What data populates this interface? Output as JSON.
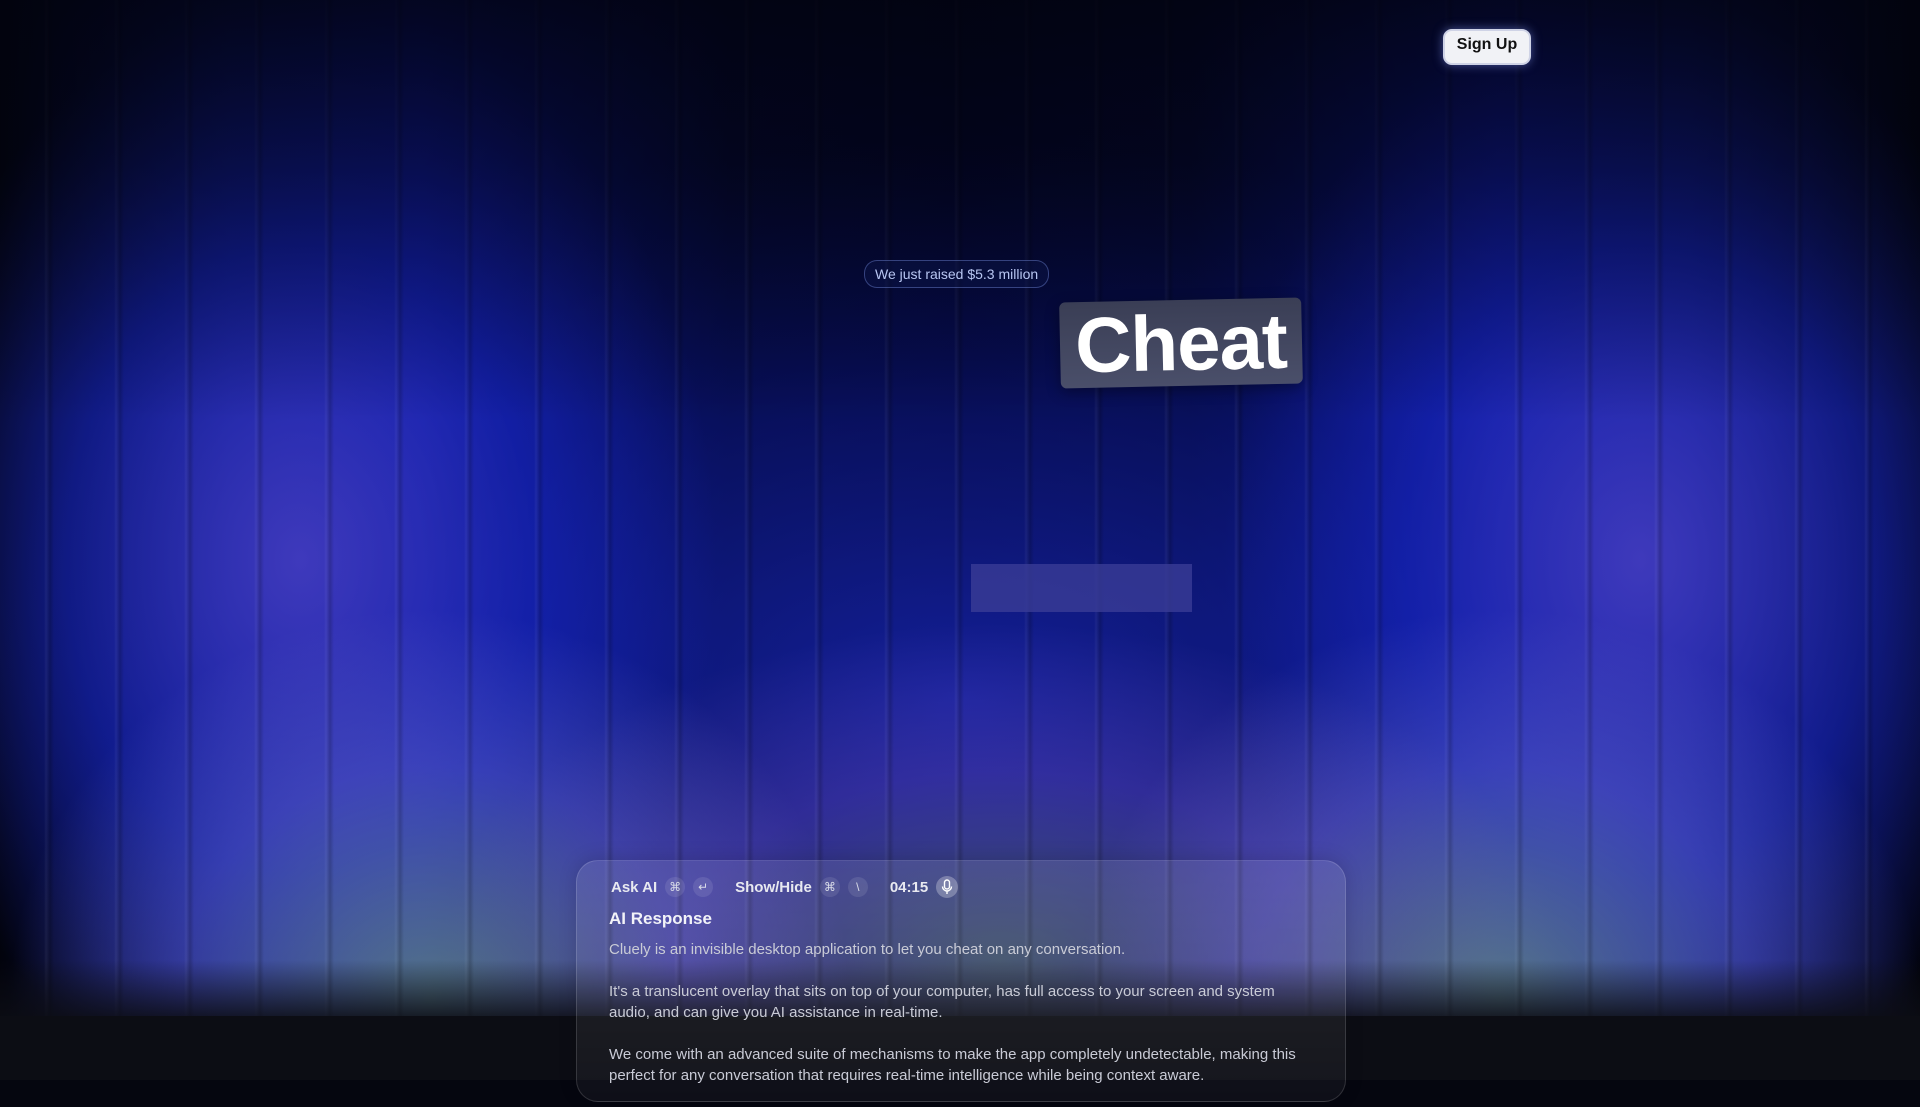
{
  "header": {
    "signup_label": "Sign Up"
  },
  "hero": {
    "announcement": "We just raised $5.3 million",
    "highlight_word": "Cheat"
  },
  "overlay": {
    "ask_label": "Ask AI",
    "ask_keys": [
      "⌘",
      "↵"
    ],
    "toggle_label": "Show/Hide",
    "toggle_keys": [
      "⌘",
      "\\"
    ],
    "timer": "04:15",
    "response_title": "AI Response",
    "paragraphs": [
      "Cluely is an invisible desktop application  to let you cheat on any conversation.",
      "It's a translucent overlay that sits on top of your computer, has full access to your screen and system audio, and can give you AI assistance in real-time.",
      "We come with an advanced suite of mechanisms to make the app completely undetectable, making this perfect for any conversation that requires real-time intelligence while being context aware."
    ]
  },
  "icons": {
    "mic": "microphone-icon"
  },
  "colors": {
    "accent_blue": "#0b1590",
    "panel_text": "#c9cbd6",
    "signup_bg": "#f1f2f6"
  }
}
